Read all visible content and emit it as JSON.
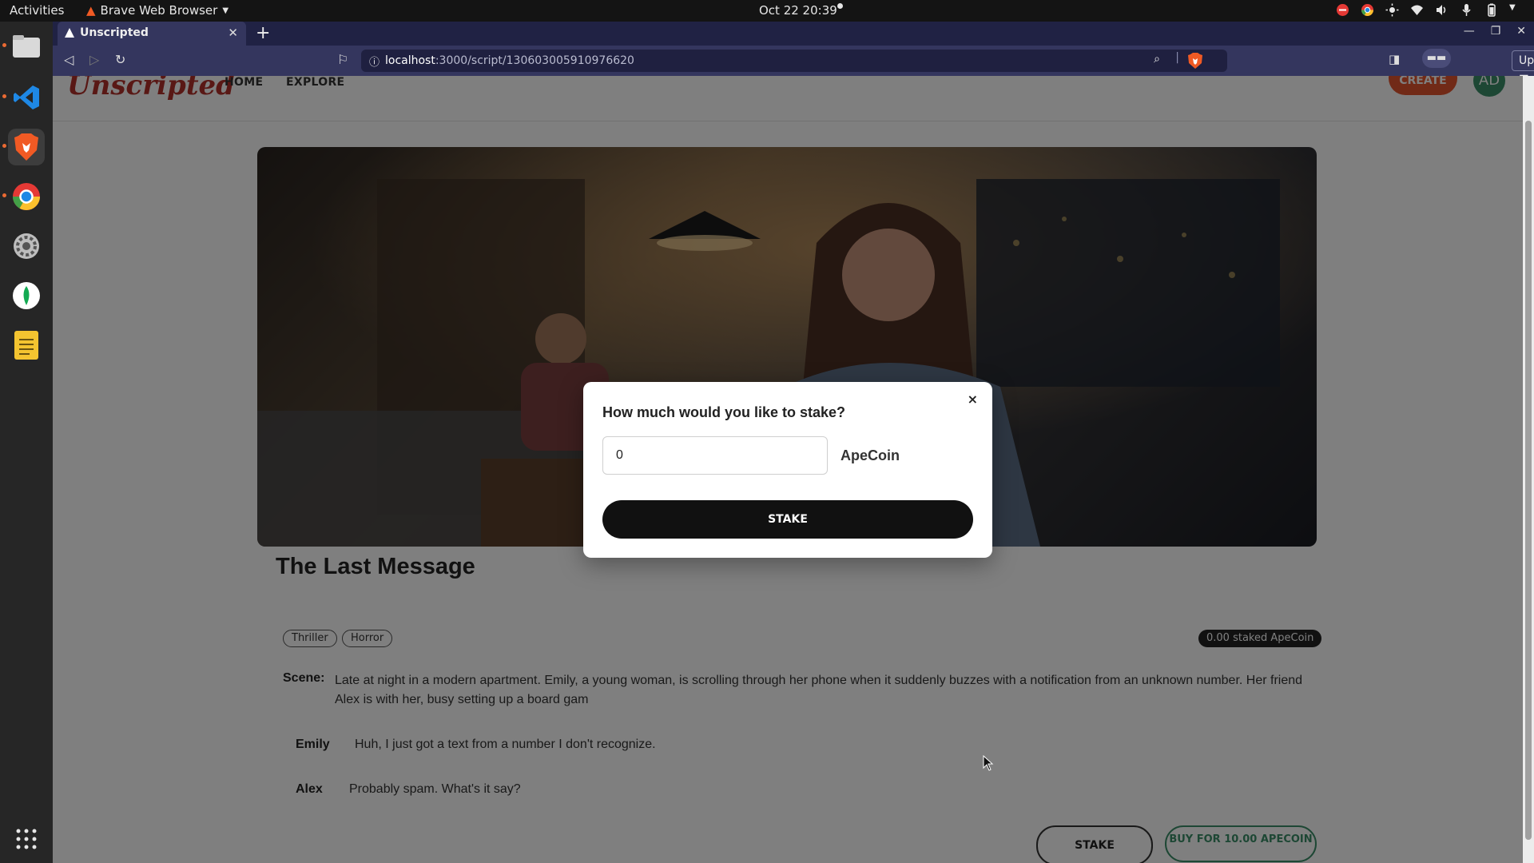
{
  "os": {
    "activities": "Activities",
    "app_name": "Brave Web Browser",
    "clock": "Oct 22  20:39",
    "tray_icons": [
      "do-not-disturb-icon",
      "chrome-icon",
      "brightness-icon",
      "wifi-icon",
      "volume-icon",
      "microphone-icon",
      "battery-icon"
    ]
  },
  "dock": {
    "apps": [
      {
        "name": "files-icon",
        "color": "#d9d9d9"
      },
      {
        "name": "vscode-icon",
        "color": "#1e88e5"
      },
      {
        "name": "brave-icon",
        "color": "#f15a24"
      },
      {
        "name": "chrome-icon",
        "color": "#4285f4"
      },
      {
        "name": "settings-icon",
        "color": "#9e9e9e"
      },
      {
        "name": "mongodb-compass-icon",
        "color": "#13aa52"
      },
      {
        "name": "text-editor-icon",
        "color": "#f4c430"
      }
    ],
    "grid_icon": "show-apps-icon"
  },
  "browser": {
    "tab_title": "Unscripted",
    "url_host": "localhost",
    "url_path": ":3000/script/130603005910976620",
    "update_label": "Update"
  },
  "site": {
    "logo": "Unscripted",
    "nav": [
      "HOME",
      "EXPLORE"
    ],
    "create_label": "CREATE",
    "avatar_initials": "AD"
  },
  "story": {
    "title": "The Last Message",
    "tags": [
      "Thriller",
      "Horror"
    ],
    "staked": "0.00 staked ApeCoin",
    "scene_label": "Scene:",
    "scene_text": "Late at night in a modern apartment. Emily, a young woman, is scrolling through her phone when it suddenly buzzes with a notification from an unknown number. Her friend Alex is with her, busy setting up a board gam",
    "lines": [
      {
        "speaker": "Emily",
        "text": "Huh, I just got a text from a number I don't recognize."
      },
      {
        "speaker": "Alex",
        "text": "Probably spam. What's it say?"
      }
    ],
    "stake_label": "STAKE",
    "buy_label": "BUY FOR 10.00 APECOIN"
  },
  "modal": {
    "title": "How much would you like to stake?",
    "input_value": "0",
    "currency": "ApeCoin",
    "stake_button": "STAKE",
    "close": "×"
  }
}
